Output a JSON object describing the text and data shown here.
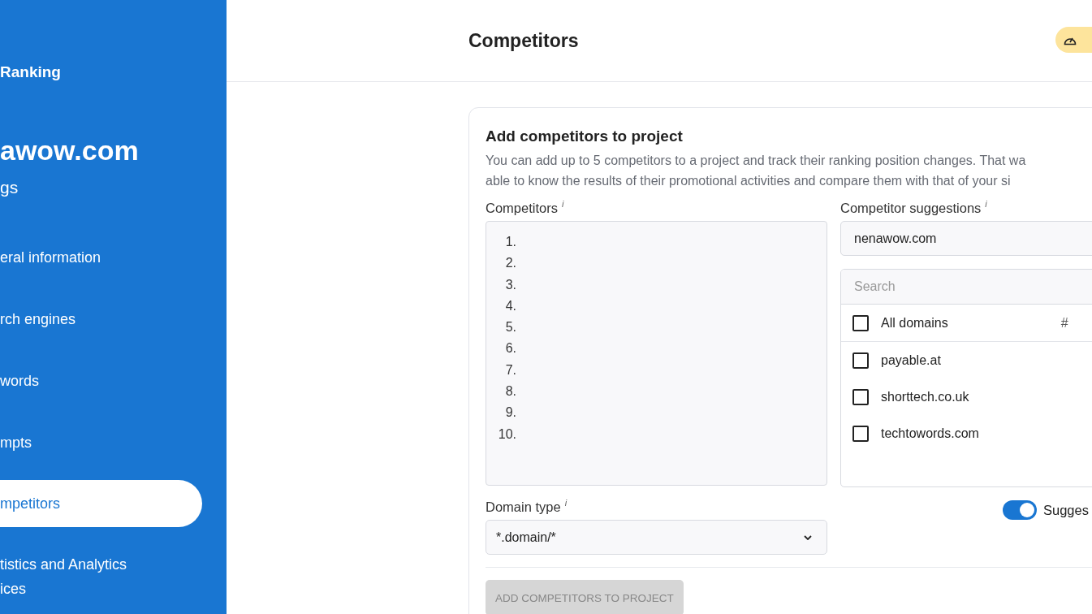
{
  "sidebar": {
    "app_title": "Ranking",
    "project": "awow.com",
    "section": "gs",
    "items": [
      {
        "label": "eral information",
        "selected": false
      },
      {
        "label": "rch engines",
        "selected": false
      },
      {
        "label": "words",
        "selected": false
      },
      {
        "label": "mpts",
        "selected": false
      },
      {
        "label": "mpetitors",
        "selected": true
      },
      {
        "label": "tistics and Analytics\nices",
        "selected": false
      }
    ]
  },
  "header": {
    "title": "Competitors",
    "badge": {
      "kind": "speed"
    }
  },
  "card": {
    "title": "Add competitors to project",
    "description_lines": [
      "You can add up to 5 competitors to a project and track their ranking position changes. That wa",
      "able to know the results of their promotional activities and compare them with that of your si"
    ],
    "competitors": {
      "label": "Competitors",
      "info": "i",
      "line_numbers": [
        "1.",
        "2.",
        "3.",
        "4.",
        "5.",
        "6.",
        "7.",
        "8.",
        "9.",
        "10."
      ]
    },
    "suggestions": {
      "label": "Competitor suggestions",
      "info": "i",
      "domain": "nenawow.com",
      "search_placeholder": "Search",
      "all": {
        "label": "All domains",
        "checked": false,
        "column": "#"
      },
      "domains": [
        {
          "label": "payable.at",
          "checked": false
        },
        {
          "label": "shorttech.co.uk",
          "checked": false
        },
        {
          "label": "techtowords.com",
          "checked": false
        }
      ]
    },
    "domain_type": {
      "label": "Domain type",
      "info": "i",
      "value": "*.domain/*"
    },
    "toggle": {
      "label": "Sugges",
      "on": true
    },
    "submit": {
      "label": "ADD COMPETITORS TO PROJECT",
      "disabled": true
    }
  }
}
